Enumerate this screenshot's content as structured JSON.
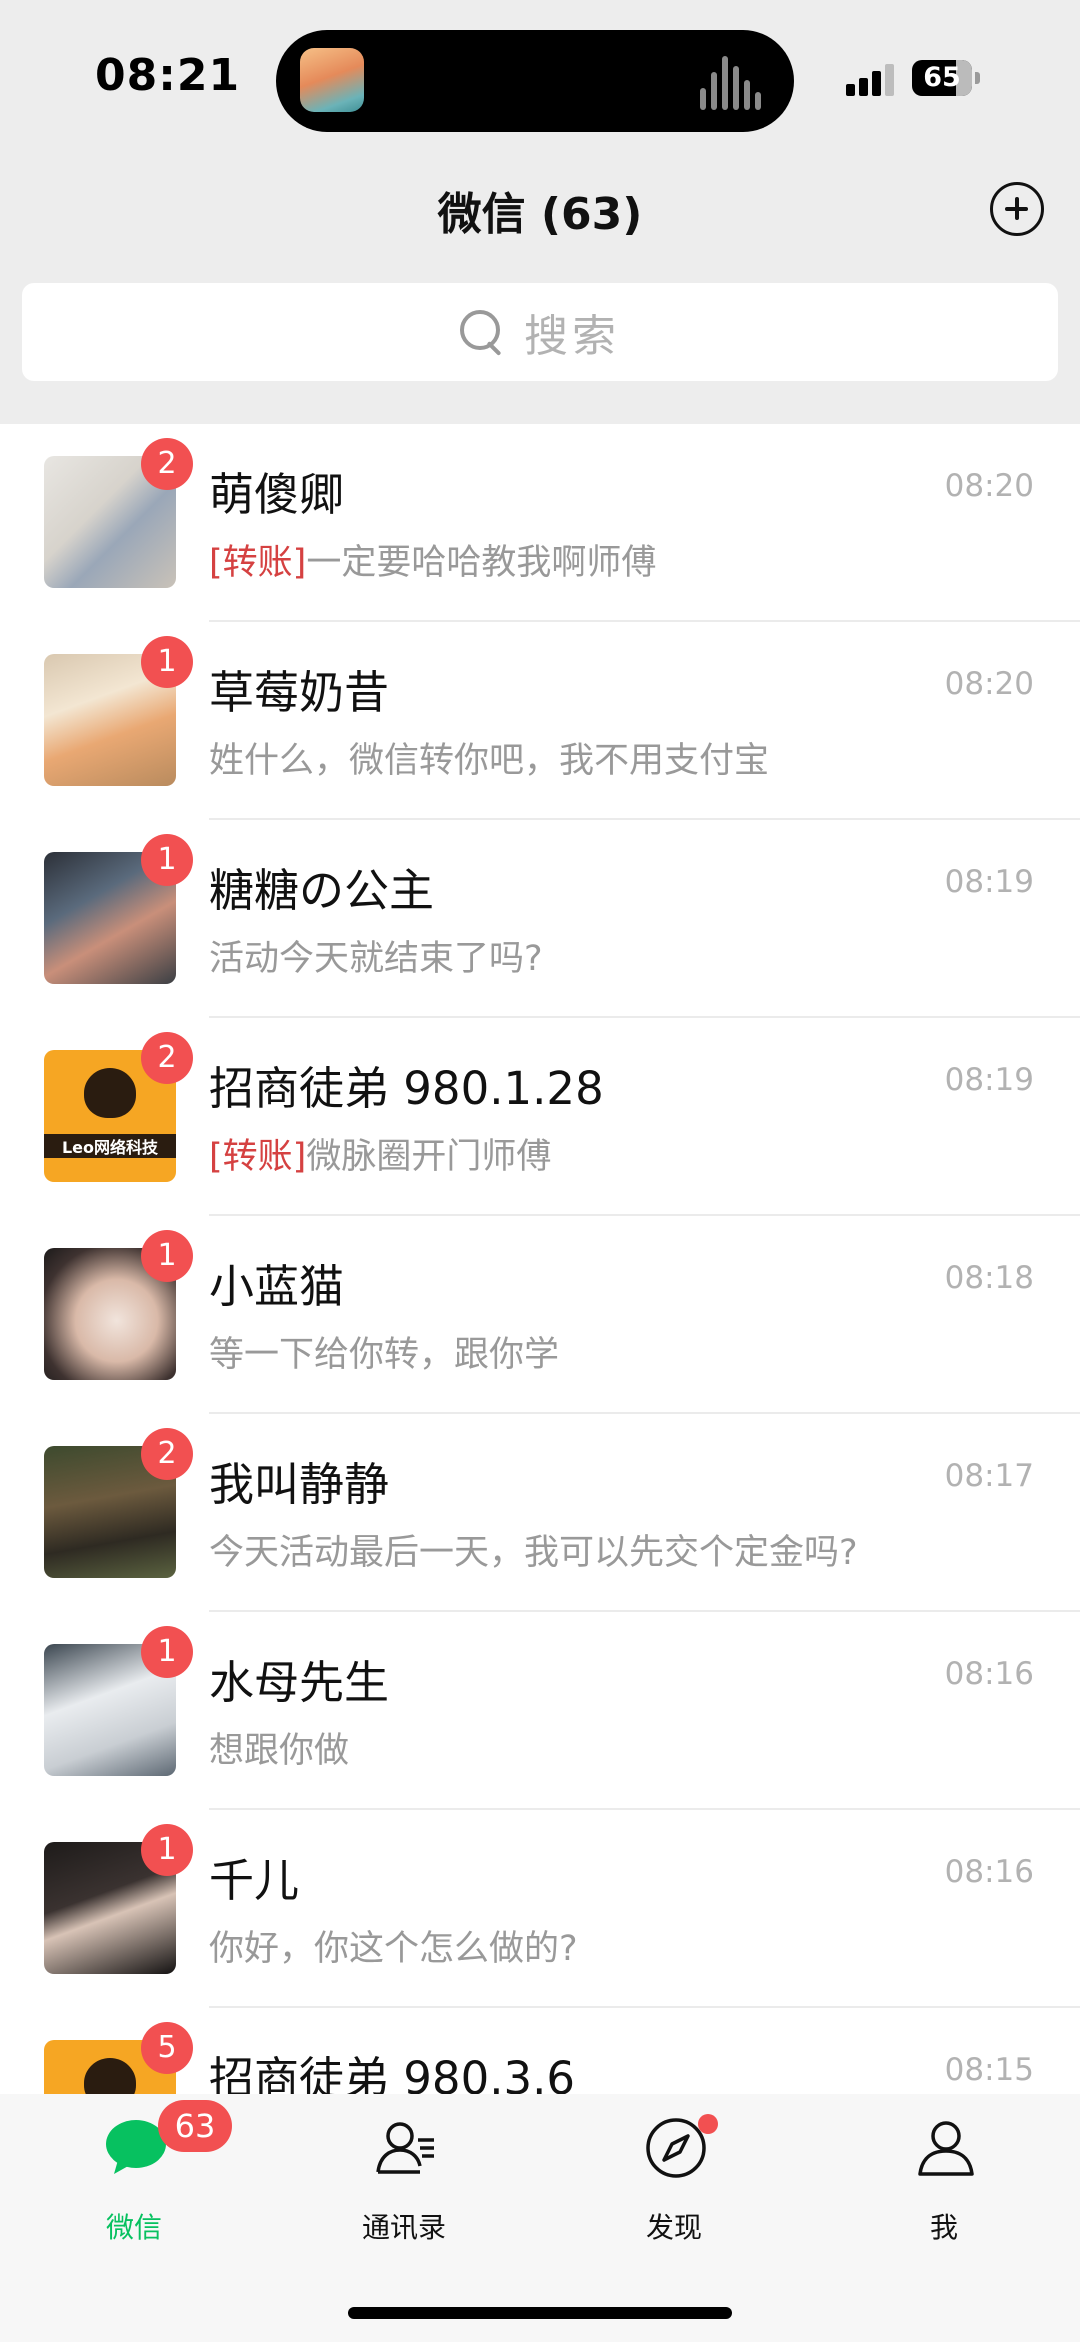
{
  "status_bar": {
    "time": "08:21",
    "battery": "65"
  },
  "header": {
    "title": "微信 (63)"
  },
  "search": {
    "placeholder": "搜索"
  },
  "chats": [
    {
      "name": "萌傻卿",
      "time": "08:20",
      "tag": "[转账]",
      "preview": "一定要哈哈教我啊师傅",
      "unread": "2"
    },
    {
      "name": "草莓奶昔",
      "time": "08:20",
      "tag": "",
      "preview": "姓什么，微信转你吧，我不用支付宝",
      "unread": "1"
    },
    {
      "name": "糖糖の公主",
      "time": "08:19",
      "tag": "",
      "preview": "活动今天就结束了吗?",
      "unread": "1"
    },
    {
      "name": "招商徒弟 980.1.28",
      "time": "08:19",
      "tag": "[转账]",
      "preview": "微脉圈开门师傅",
      "unread": "2",
      "avatar_text": "Leo网络科技"
    },
    {
      "name": "小蓝猫",
      "time": "08:18",
      "tag": "",
      "preview": "等一下给你转，跟你学",
      "unread": "1"
    },
    {
      "name": "我叫静静",
      "time": "08:17",
      "tag": "",
      "preview": "今天活动最后一天，我可以先交个定金吗?",
      "unread": "2"
    },
    {
      "name": "水母先生",
      "time": "08:16",
      "tag": "",
      "preview": "想跟你做",
      "unread": "1"
    },
    {
      "name": "千儿",
      "time": "08:16",
      "tag": "",
      "preview": "你好，你这个怎么做的?",
      "unread": "1"
    },
    {
      "name": "招商徒弟 980.3.6",
      "time": "08:15",
      "tag": "",
      "preview": "",
      "unread": "5"
    }
  ],
  "tab_bar": {
    "chats": {
      "label": "微信",
      "badge": "63"
    },
    "contacts": {
      "label": "通讯录"
    },
    "discover": {
      "label": "发现"
    },
    "me": {
      "label": "我"
    }
  },
  "colors": {
    "accent_green": "#07c160",
    "badge_red": "#f25051",
    "transfer_tag": "#d54141"
  }
}
